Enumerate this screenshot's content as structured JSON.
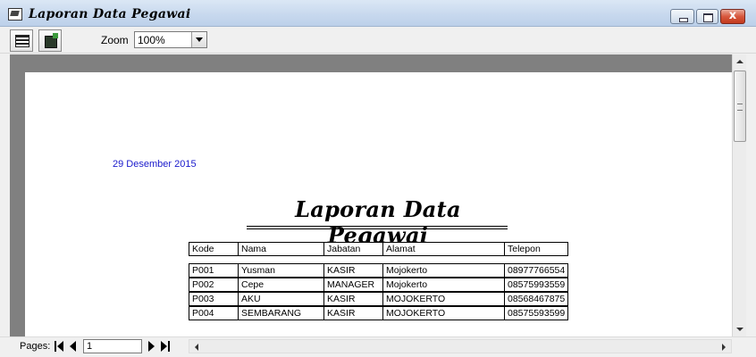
{
  "window": {
    "title": "Laporan Data Pegawai",
    "close_glyph": "x"
  },
  "toolbar": {
    "print_icon": "printer-icon",
    "export_icon": "export-icon",
    "zoom_label": "Zoom",
    "zoom_value": "100%"
  },
  "report": {
    "date": "29 Desember 2015",
    "title": "Laporan Data Pegawai",
    "columns": [
      "Kode",
      "Nama",
      "Jabatan",
      "Alamat",
      "Telepon"
    ],
    "rows": [
      [
        "P001",
        "Yusman",
        "KASIR",
        "Mojokerto",
        "08977766554"
      ],
      [
        "P002",
        "Cepe",
        "MANAGER",
        "Mojokerto",
        "08575993559"
      ],
      [
        "P003",
        "AKU",
        "KASIR",
        "MOJOKERTO",
        "08568467875"
      ],
      [
        "P004",
        "SEMBARANG",
        "KASIR",
        "MOJOKERTO",
        "08575593599"
      ]
    ]
  },
  "status": {
    "pages_label": "Pages:",
    "page_value": "1"
  },
  "colors": {
    "date_color": "#1a1acc",
    "viewport_bg": "#808080",
    "close_button": "#c23a1e"
  }
}
